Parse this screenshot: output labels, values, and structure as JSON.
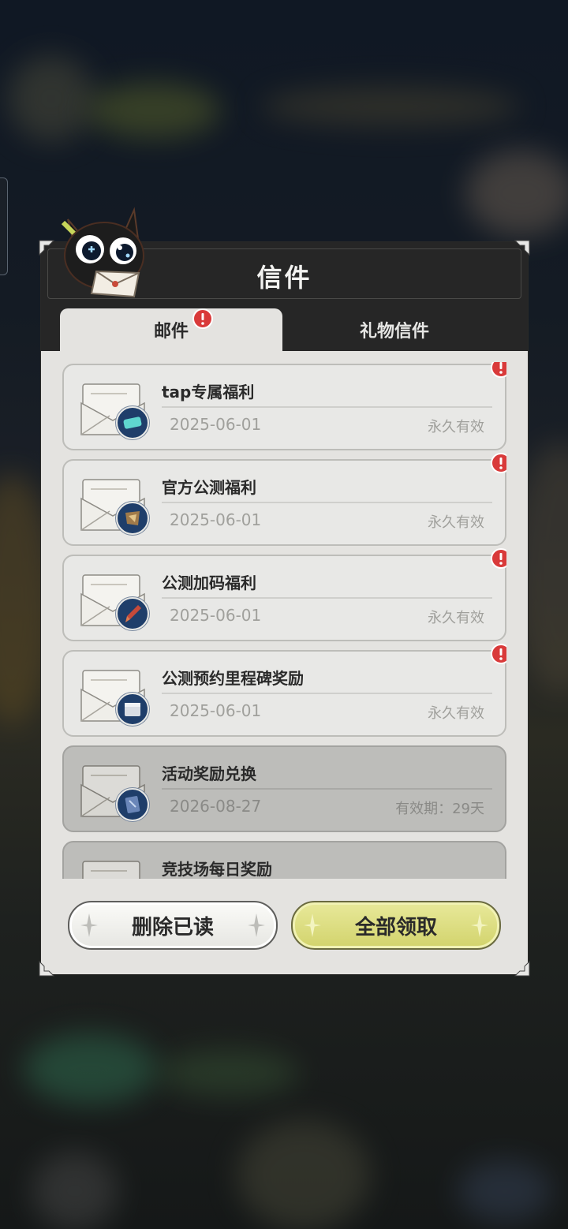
{
  "dialog": {
    "title": "信件",
    "tabs": [
      {
        "label": "邮件",
        "active": true,
        "has_badge": true
      },
      {
        "label": "礼物信件",
        "active": false,
        "has_badge": false
      }
    ]
  },
  "mails": [
    {
      "title": "tap专属福利",
      "date": "2025-06-01",
      "validity": "永久有效",
      "read": false,
      "icon": "tap-coupon-icon"
    },
    {
      "title": "官方公测福利",
      "date": "2025-06-01",
      "validity": "永久有效",
      "read": false,
      "icon": "crafting-materials-icon"
    },
    {
      "title": "公测加码福利",
      "date": "2025-06-01",
      "validity": "永久有效",
      "read": false,
      "icon": "brush-icon"
    },
    {
      "title": "公测预约里程碑奖励",
      "date": "2025-06-01",
      "validity": "永久有效",
      "read": false,
      "icon": "gift-box-icon"
    },
    {
      "title": "活动奖励兑换",
      "date": "2026-08-27",
      "validity": "有效期：29天",
      "read": true,
      "icon": "crystal-card-icon"
    },
    {
      "title": "竞技场每日奖励",
      "date": "",
      "validity": "",
      "read": true,
      "icon": ""
    }
  ],
  "buttons": {
    "delete_read": "删除已读",
    "claim_all": "全部领取"
  },
  "colors": {
    "header": "#262626",
    "panel": "#e4e3e0",
    "claim_button": "#d8d97a",
    "badge": "#d93a3a"
  }
}
